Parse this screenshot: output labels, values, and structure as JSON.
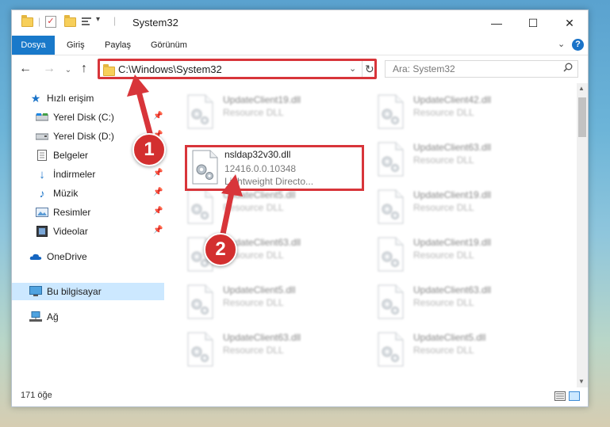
{
  "window": {
    "title": "System32",
    "controls": {
      "minimize": "—",
      "maximize": "☐",
      "close": "✕"
    }
  },
  "ribbon": {
    "tabs": [
      "Dosya",
      "Giriş",
      "Paylaş",
      "Görünüm"
    ],
    "active_tab": "Dosya",
    "expand_glyph": "⌄",
    "help_glyph": "?"
  },
  "nav": {
    "back": "←",
    "forward": "→",
    "recent": "⌄",
    "up": "↑",
    "address": "C:\\Windows\\System32",
    "address_dropdown": "⌄",
    "refresh": "↻",
    "search_placeholder": "Ara: System32",
    "search_icon": "search-icon"
  },
  "sidebar": {
    "items": [
      {
        "label": "Hızlı erişim",
        "icon": "star-icon",
        "pinned": false
      },
      {
        "label": "Yerel Disk (C:)",
        "icon": "drive-icon",
        "pinned": true
      },
      {
        "label": "Yerel Disk (D:)",
        "icon": "drive-icon",
        "pinned": true
      },
      {
        "label": "Belgeler",
        "icon": "document-icon",
        "pinned": true
      },
      {
        "label": "İndirmeler",
        "icon": "download-icon",
        "pinned": true
      },
      {
        "label": "Müzik",
        "icon": "music-icon",
        "pinned": true
      },
      {
        "label": "Resimler",
        "icon": "pictures-icon",
        "pinned": true
      },
      {
        "label": "Videolar",
        "icon": "video-icon",
        "pinned": true
      },
      {
        "label": "OneDrive",
        "icon": "cloud-icon",
        "pinned": false
      },
      {
        "label": "Bu bilgisayar",
        "icon": "computer-icon",
        "pinned": false,
        "selected": true
      },
      {
        "label": "Ağ",
        "icon": "network-icon",
        "pinned": false
      }
    ]
  },
  "files": {
    "highlighted": {
      "name": "nsldap32v30.dll",
      "version": "12416.0.0.10348",
      "description": "Lightweight Directo..."
    },
    "background": [
      {
        "name": "UpdateClient19.dll",
        "type": "Resource DLL"
      },
      {
        "name": "UpdateClient42.dll",
        "type": "Resource DLL"
      },
      {
        "name": "UpdateClient63.dll",
        "type": "Resource DLL"
      },
      {
        "name": "UpdateClient5.dll",
        "type": "Resource DLL"
      },
      {
        "name": "UpdateClient19.dll",
        "type": "Resource DLL"
      },
      {
        "name": "UpdateClient63.dll",
        "type": "Resource DLL"
      },
      {
        "name": "UpdateClient19.dll",
        "type": "Resource DLL"
      },
      {
        "name": "UpdateClient5.dll",
        "type": "Resource DLL"
      },
      {
        "name": "UpdateClient63.dll",
        "type": "Resource DLL"
      },
      {
        "name": "UpdateClient63.dll",
        "type": "Resource DLL"
      },
      {
        "name": "UpdateClient5.dll",
        "type": "Resource DLL"
      }
    ]
  },
  "status": {
    "item_count": "171 öğe"
  },
  "annotations": {
    "step1": "1",
    "step2": "2"
  },
  "colors": {
    "accent": "#1979ca",
    "highlight_border": "#d8353a",
    "selection": "#cce8ff"
  }
}
